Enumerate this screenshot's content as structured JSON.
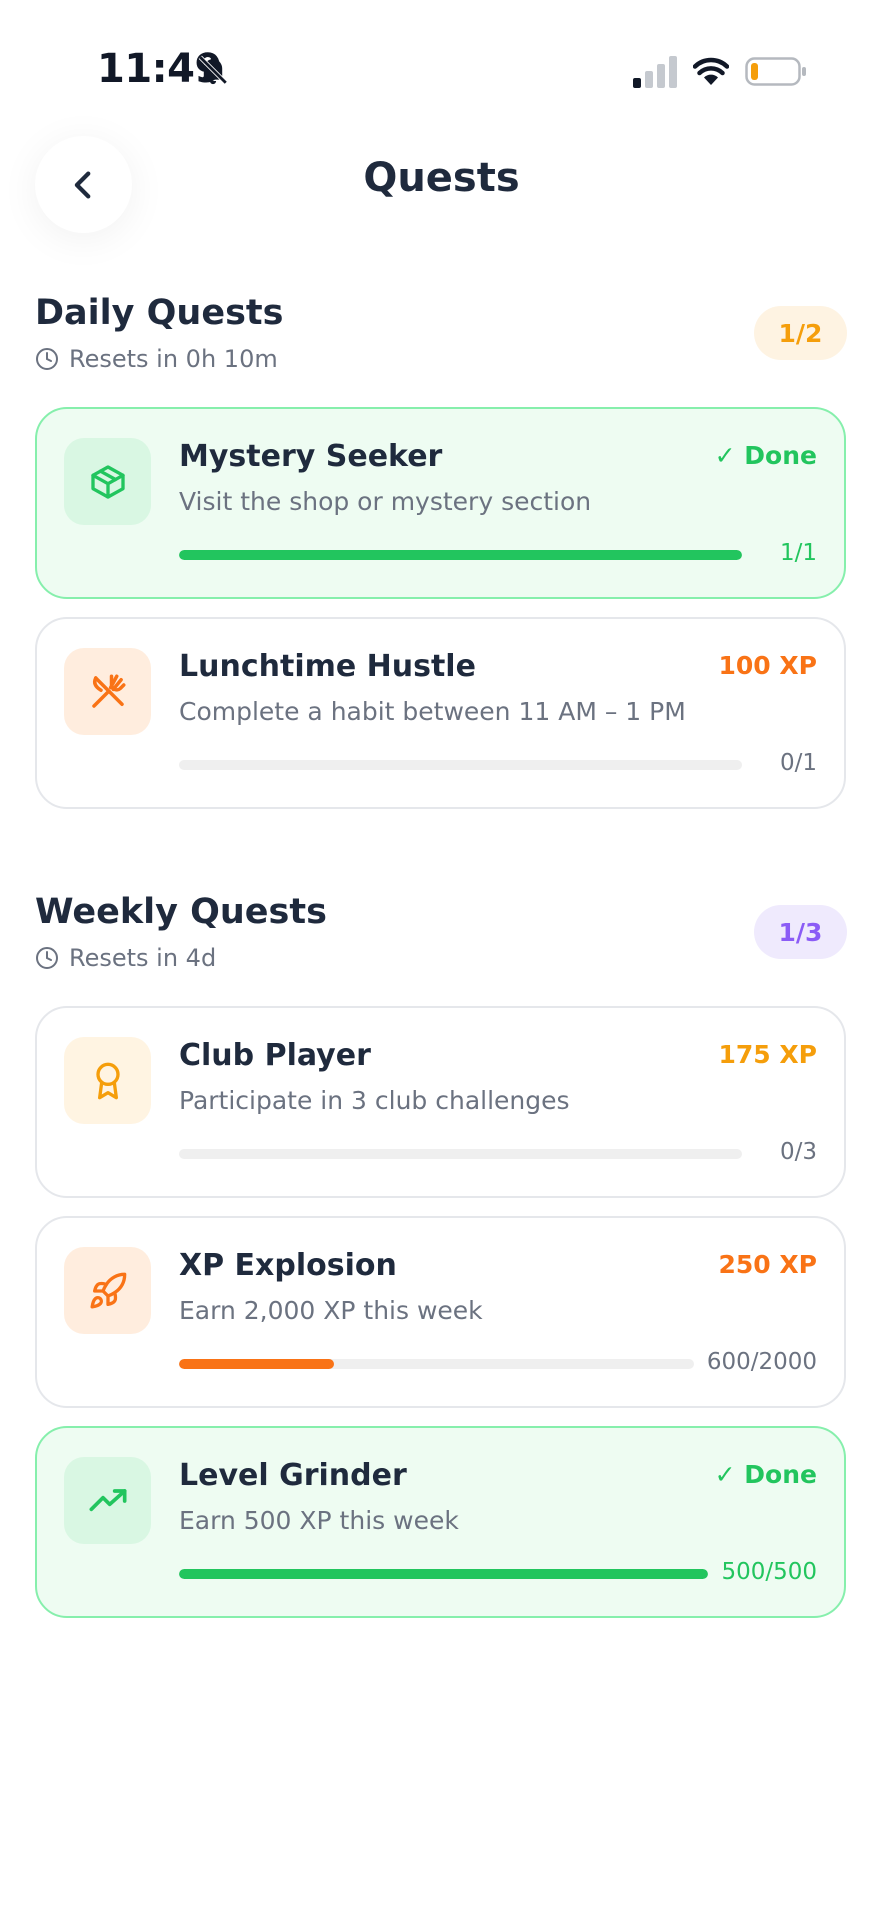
{
  "status_bar": {
    "time": "11:49",
    "colors": {
      "battery_level": "#f59e0b"
    }
  },
  "header": {
    "title": "Quests",
    "back_icon": "chevron-left-icon"
  },
  "daily": {
    "title": "Daily Quests",
    "reset_text": "Resets in 0h 10m",
    "count": "1/2",
    "badge_color": "#f59e0b",
    "quests": [
      {
        "title": "Mystery Seeker",
        "description": "Visit the shop or mystery section",
        "reward": "✓ Done",
        "progress_text": "1/1",
        "progress": 1.0,
        "done": true,
        "icon": "package-icon"
      },
      {
        "title": "Lunchtime Hustle",
        "description": "Complete a habit between 11 AM – 1 PM",
        "reward": "100 XP",
        "progress_text": "0/1",
        "progress": 0.0,
        "done": false,
        "icon": "utensils-icon"
      }
    ]
  },
  "weekly": {
    "title": "Weekly Quests",
    "reset_text": "Resets in 4d",
    "count": "1/3",
    "badge_color": "#8b5cf6",
    "quests": [
      {
        "title": "Club Player",
        "description": "Participate in 3 club challenges",
        "reward": "175 XP",
        "progress_text": "0/3",
        "progress": 0.0,
        "done": false,
        "icon": "award-icon"
      },
      {
        "title": "XP Explosion",
        "description": "Earn 2,000 XP this week",
        "reward": "250 XP",
        "progress_text": "600/2000",
        "progress": 0.3,
        "done": false,
        "icon": "rocket-icon"
      },
      {
        "title": "Level Grinder",
        "description": "Earn 500 XP this week",
        "reward": "✓ Done",
        "progress_text": "500/500",
        "progress": 1.0,
        "done": true,
        "icon": "trending-up-icon"
      }
    ]
  },
  "colors": {
    "done_green": "#22c55e",
    "xp_orange": "#f97316",
    "xp_amber": "#f59e0b",
    "track_gray": "#efefef"
  }
}
